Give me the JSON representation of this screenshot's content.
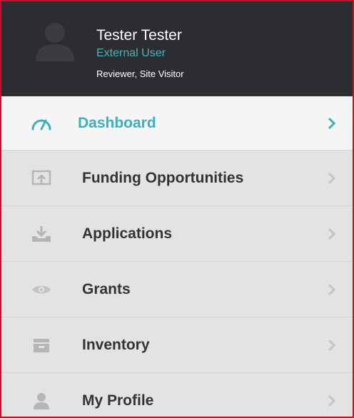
{
  "user": {
    "name": "Tester Tester",
    "type": "External User",
    "roles": "Reviewer, Site Visitor"
  },
  "menu": {
    "items": [
      {
        "label": "Dashboard",
        "icon": "dashboard-gauge-icon",
        "active": true
      },
      {
        "label": "Funding Opportunities",
        "icon": "upload-screen-icon",
        "active": false
      },
      {
        "label": "Applications",
        "icon": "download-tray-icon",
        "active": false
      },
      {
        "label": "Grants",
        "icon": "eye-icon",
        "active": false
      },
      {
        "label": "Inventory",
        "icon": "inbox-box-icon",
        "active": false
      },
      {
        "label": "My Profile",
        "icon": "user-icon",
        "active": false
      }
    ]
  },
  "colors": {
    "accent": "#3fb0bb",
    "header_bg": "#2b2d30",
    "menu_bg": "#e3e3e3",
    "active_bg": "#f5f5f5",
    "border": "#c8102e"
  }
}
